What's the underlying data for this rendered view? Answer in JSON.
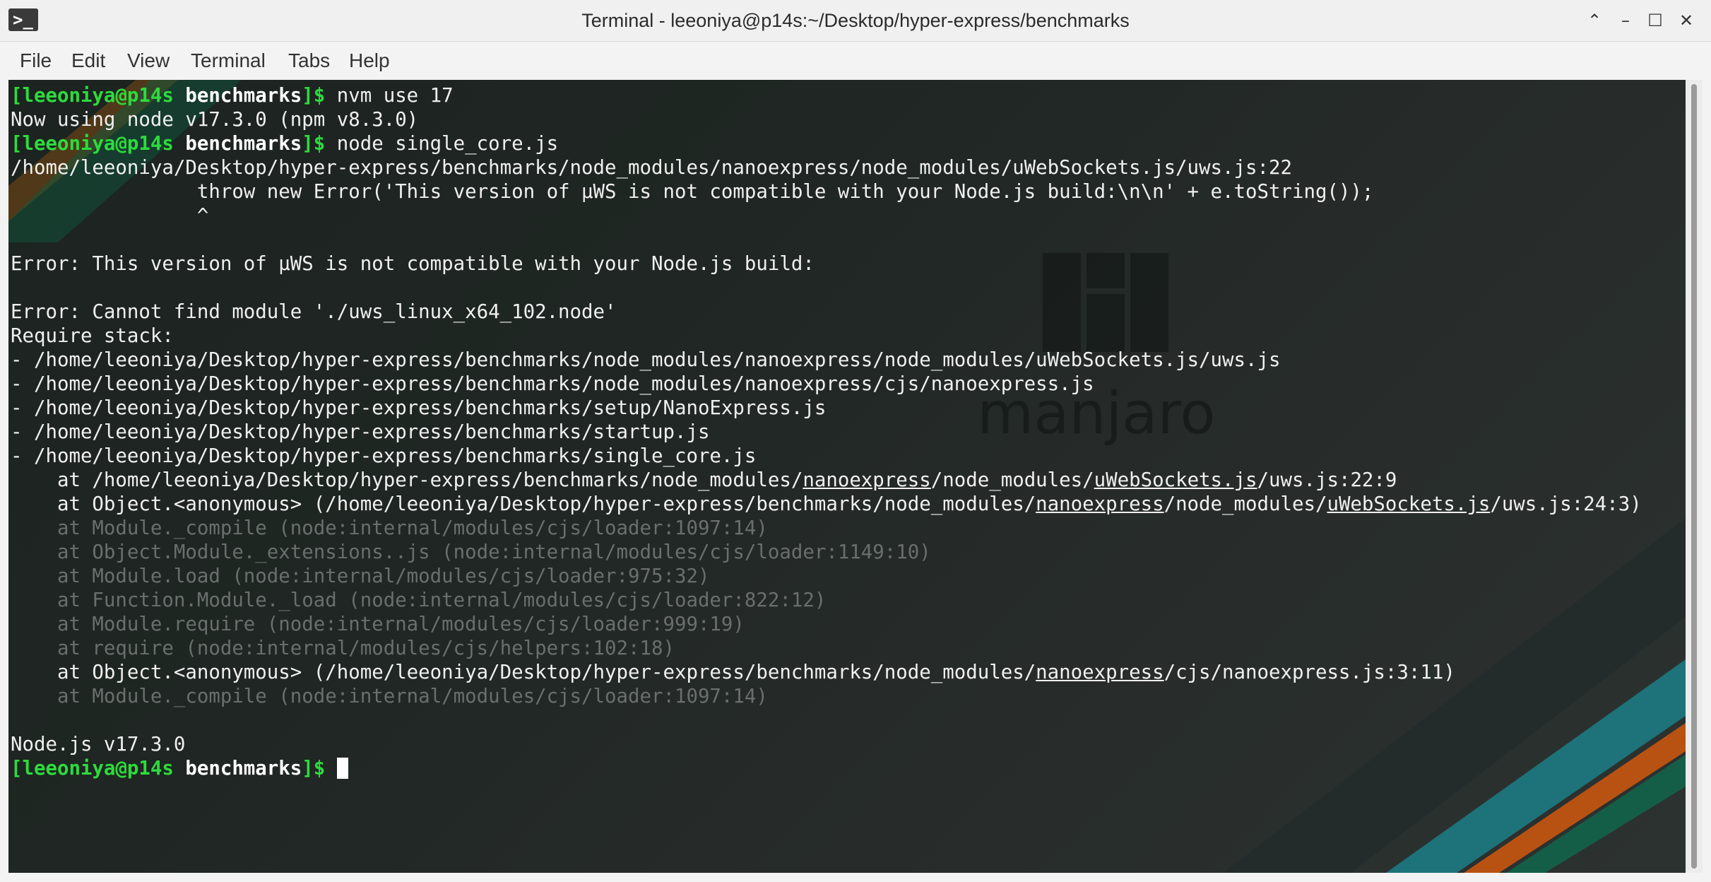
{
  "window": {
    "title": "Terminal - leeoniya@p14s:~/Desktop/hyper-express/benchmarks",
    "app_icon_glyph": ">_",
    "controls": {
      "shade": "⌃",
      "minimize": "–",
      "maximize": "☐",
      "close": "✕"
    }
  },
  "menu": [
    "File",
    "Edit",
    "View",
    "Terminal",
    "Tabs",
    "Help"
  ],
  "wallpaper": {
    "logo_text": "manjaro"
  },
  "prompt": {
    "user_host": "[leeoniya@p14s",
    "dir": "benchmarks",
    "suffix": "]$"
  },
  "lines": [
    {
      "segs": [
        {
          "t": "[leeoniya@p14s ",
          "c": "prompt"
        },
        {
          "t": "benchmarks",
          "c": "dir"
        },
        {
          "t": "]$",
          "c": "prompt"
        },
        {
          "t": " nvm use 17"
        }
      ]
    },
    {
      "segs": [
        {
          "t": "Now using node v17.3.0 (npm v8.3.0)"
        }
      ]
    },
    {
      "segs": [
        {
          "t": "[leeoniya@p14s ",
          "c": "prompt"
        },
        {
          "t": "benchmarks",
          "c": "dir"
        },
        {
          "t": "]$",
          "c": "prompt"
        },
        {
          "t": " node single_core.js"
        }
      ]
    },
    {
      "segs": [
        {
          "t": "/home/leeoniya/Desktop/hyper-express/benchmarks/node_modules/nanoexpress/node_modules/uWebSockets.js/uws.js:22"
        }
      ]
    },
    {
      "segs": [
        {
          "t": "                throw new Error('This version of µWS is not compatible with your Node.js build:\\n\\n' + e.toString());"
        }
      ]
    },
    {
      "segs": [
        {
          "t": "                ^"
        }
      ]
    },
    {
      "segs": [
        {
          "t": ""
        }
      ]
    },
    {
      "segs": [
        {
          "t": "Error: This version of µWS is not compatible with your Node.js build:"
        }
      ]
    },
    {
      "segs": [
        {
          "t": ""
        }
      ]
    },
    {
      "segs": [
        {
          "t": "Error: Cannot find module './uws_linux_x64_102.node'"
        }
      ]
    },
    {
      "segs": [
        {
          "t": "Require stack:"
        }
      ]
    },
    {
      "segs": [
        {
          "t": "- /home/leeoniya/Desktop/hyper-express/benchmarks/node_modules/nanoexpress/node_modules/uWebSockets.js/uws.js"
        }
      ]
    },
    {
      "segs": [
        {
          "t": "- /home/leeoniya/Desktop/hyper-express/benchmarks/node_modules/nanoexpress/cjs/nanoexpress.js"
        }
      ]
    },
    {
      "segs": [
        {
          "t": "- /home/leeoniya/Desktop/hyper-express/benchmarks/setup/NanoExpress.js"
        }
      ]
    },
    {
      "segs": [
        {
          "t": "- /home/leeoniya/Desktop/hyper-express/benchmarks/startup.js"
        }
      ]
    },
    {
      "segs": [
        {
          "t": "- /home/leeoniya/Desktop/hyper-express/benchmarks/single_core.js"
        }
      ]
    },
    {
      "segs": [
        {
          "t": "    at /home/leeoniya/Desktop/hyper-express/benchmarks/node_modules/"
        },
        {
          "t": "nanoexpress",
          "c": "ul"
        },
        {
          "t": "/node_modules/"
        },
        {
          "t": "uWebSockets.js",
          "c": "ul"
        },
        {
          "t": "/uws.js:22:9"
        }
      ]
    },
    {
      "segs": [
        {
          "t": "    at Object.<anonymous> (/home/leeoniya/Desktop/hyper-express/benchmarks/node_modules/"
        },
        {
          "t": "nanoexpress",
          "c": "ul"
        },
        {
          "t": "/node_modules/"
        },
        {
          "t": "uWebSockets.js",
          "c": "ul"
        },
        {
          "t": "/uws.js:24:3)"
        }
      ]
    },
    {
      "segs": [
        {
          "t": "    at Module._compile (node:internal/modules/cjs/loader:1097:14)",
          "c": "dim"
        }
      ]
    },
    {
      "segs": [
        {
          "t": "    at Object.Module._extensions..js (node:internal/modules/cjs/loader:1149:10)",
          "c": "dim"
        }
      ]
    },
    {
      "segs": [
        {
          "t": "    at Module.load (node:internal/modules/cjs/loader:975:32)",
          "c": "dim"
        }
      ]
    },
    {
      "segs": [
        {
          "t": "    at Function.Module._load (node:internal/modules/cjs/loader:822:12)",
          "c": "dim"
        }
      ]
    },
    {
      "segs": [
        {
          "t": "    at Module.require (node:internal/modules/cjs/loader:999:19)",
          "c": "dim"
        }
      ]
    },
    {
      "segs": [
        {
          "t": "    at require (node:internal/modules/cjs/helpers:102:18)",
          "c": "dim"
        }
      ]
    },
    {
      "segs": [
        {
          "t": "    at Object.<anonymous> (/home/leeoniya/Desktop/hyper-express/benchmarks/node_modules/"
        },
        {
          "t": "nanoexpress",
          "c": "ul"
        },
        {
          "t": "/cjs/nanoexpress.js:3:11)"
        }
      ]
    },
    {
      "segs": [
        {
          "t": "    at Module._compile (node:internal/modules/cjs/loader:1097:14)",
          "c": "dim"
        }
      ]
    },
    {
      "segs": [
        {
          "t": ""
        }
      ]
    },
    {
      "segs": [
        {
          "t": "Node.js v17.3.0"
        }
      ]
    },
    {
      "segs": [
        {
          "t": "[leeoniya@p14s ",
          "c": "prompt"
        },
        {
          "t": "benchmarks",
          "c": "dir"
        },
        {
          "t": "]$",
          "c": "prompt"
        },
        {
          "t": " "
        }
      ],
      "cursor": true
    }
  ],
  "colors": {
    "prompt": "#2ddb3c",
    "text": "#f0f0f0",
    "dim_text": "#6a6f6d",
    "background": "#1f2623",
    "stripe_orange": "#c8560f",
    "stripe_teal": "#1b7f86",
    "stripe_green": "#0f6a4f"
  }
}
